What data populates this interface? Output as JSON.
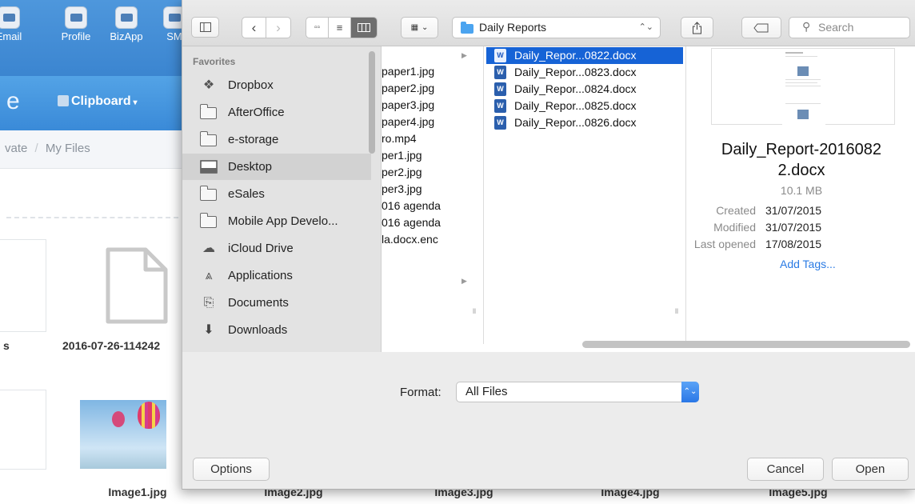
{
  "background": {
    "toolbar_items": [
      {
        "label": "Email",
        "icon": "email-icon"
      },
      {
        "label": "Profile",
        "icon": "profile-icon"
      },
      {
        "label": "BizApp",
        "icon": "bizapp-icon"
      },
      {
        "label": "SM",
        "icon": "sm-icon"
      }
    ],
    "section_letter": "e",
    "clipboard_label": "Clipboard",
    "breadcrumb": {
      "part1": "vate",
      "separator": "/",
      "part2": "My Files"
    },
    "file_labels": {
      "left_partial": "s",
      "document": "2016-07-26-114242"
    },
    "images": [
      "Image1.jpg",
      "Image2.jpg",
      "Image3.jpg",
      "Image4.jpg",
      "Image5.jpg"
    ]
  },
  "dialog": {
    "toolbar": {
      "location": "Daily Reports",
      "search_placeholder": "Search"
    },
    "sidebar": {
      "heading": "Favorites",
      "items": [
        {
          "label": "Dropbox",
          "icon": "dropbox-icon"
        },
        {
          "label": "AfterOffice",
          "icon": "folder-icon"
        },
        {
          "label": "e-storage",
          "icon": "folder-icon"
        },
        {
          "label": "Desktop",
          "icon": "desktop-icon",
          "selected": true
        },
        {
          "label": "eSales",
          "icon": "folder-icon"
        },
        {
          "label": "Mobile App Develo...",
          "icon": "folder-icon"
        },
        {
          "label": "iCloud Drive",
          "icon": "cloud-icon"
        },
        {
          "label": "Applications",
          "icon": "applications-icon"
        },
        {
          "label": "Documents",
          "icon": "documents-icon"
        },
        {
          "label": "Downloads",
          "icon": "downloads-icon"
        }
      ]
    },
    "column1": [
      "",
      "paper1.jpg",
      "paper2.jpg",
      "paper3.jpg",
      "paper4.jpg",
      "ro.mp4",
      "per1.jpg",
      "per2.jpg",
      "per3.jpg",
      "016 agenda",
      "016 agenda",
      "la.docx.enc"
    ],
    "files": [
      "Daily_Repor...0822.docx",
      "Daily_Repor...0823.docx",
      "Daily_Repor...0824.docx",
      "Daily_Repor...0825.docx",
      "Daily_Repor...0826.docx"
    ],
    "selected_file_index": 0,
    "preview": {
      "name_line1": "Daily_Report-2016082",
      "name_line2": "2.docx",
      "size": "10.1 MB",
      "created_label": "Created",
      "created": "31/07/2015",
      "modified_label": "Modified",
      "modified": "31/07/2015",
      "opened_label": "Last opened",
      "opened": "17/08/2015",
      "add_tags": "Add Tags..."
    },
    "format_label": "Format:",
    "format_value": "All Files",
    "options_label": "Options",
    "cancel_label": "Cancel",
    "open_label": "Open"
  },
  "colors": {
    "selection": "#1663d6",
    "link": "#2a7be4",
    "web_toolbar": "#4e97dc"
  }
}
